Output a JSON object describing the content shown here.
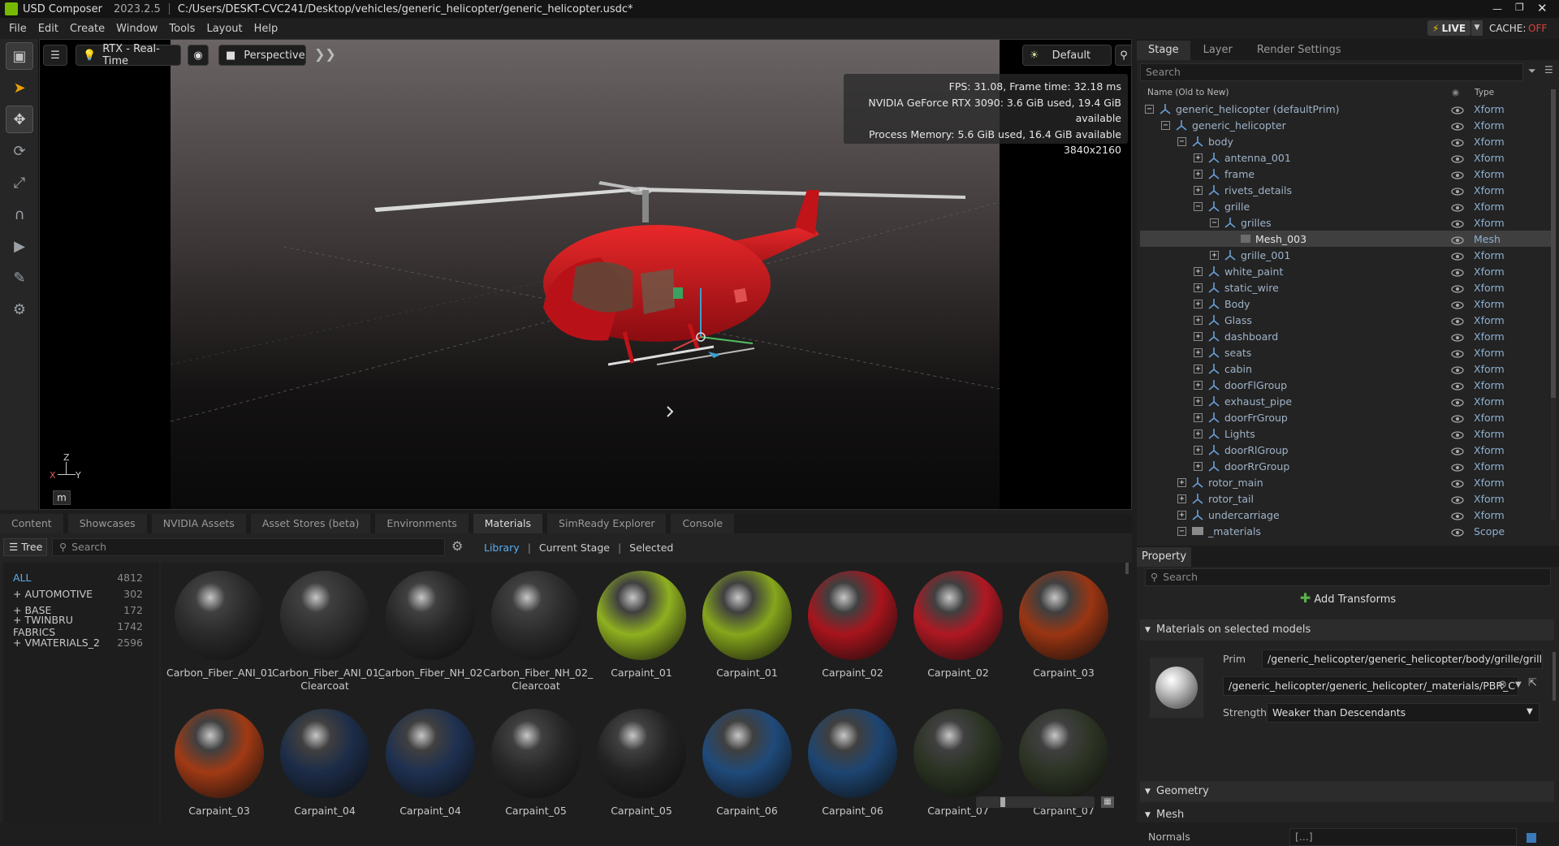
{
  "app": {
    "name": "USD Composer",
    "version": "2023.2.5",
    "file_path": "C:/Users/DESKT-CVC241/Desktop/vehicles/generic_helicopter/generic_helicopter.usdc*"
  },
  "menu": [
    "File",
    "Edit",
    "Create",
    "Window",
    "Tools",
    "Layout",
    "Help"
  ],
  "status": {
    "live": "LIVE",
    "cache_label": "CACHE:",
    "cache_value": "OFF"
  },
  "viewport": {
    "renderer": "RTX - Real-Time",
    "camera": "Perspective",
    "lighting": "Default",
    "stats": [
      "FPS: 31.08, Frame time: 32.18 ms",
      "NVIDIA GeForce RTX 3090: 3.6 GiB used, 19.4 GiB available",
      "Process Memory: 5.6 GiB used, 16.4 GiB available",
      "3840x2160"
    ],
    "axis": {
      "z": "Z",
      "x": "X",
      "y": "Y"
    },
    "unit": "m"
  },
  "stage": {
    "tabs": [
      "Stage",
      "Layer",
      "Render Settings"
    ],
    "search_placeholder": "Search",
    "col_name": "Name (Old to New)",
    "col_type": "Type",
    "rows": [
      {
        "name": "generic_helicopter (defaultPrim)",
        "type": "Xform",
        "toggle": "−"
      },
      {
        "name": "generic_helicopter",
        "type": "Xform",
        "toggle": "−"
      },
      {
        "name": "body",
        "type": "Xform",
        "toggle": "−"
      },
      {
        "name": "antenna_001",
        "type": "Xform",
        "toggle": "+"
      },
      {
        "name": "frame",
        "type": "Xform",
        "toggle": "+"
      },
      {
        "name": "rivets_details",
        "type": "Xform",
        "toggle": "+"
      },
      {
        "name": "grille",
        "type": "Xform",
        "toggle": "−"
      },
      {
        "name": "grilles",
        "type": "Xform",
        "toggle": "−"
      },
      {
        "name": "Mesh_003",
        "type": "Mesh",
        "toggle": ""
      },
      {
        "name": "grille_001",
        "type": "Xform",
        "toggle": "+"
      },
      {
        "name": "white_paint",
        "type": "Xform",
        "toggle": "+"
      },
      {
        "name": "static_wire",
        "type": "Xform",
        "toggle": "+"
      },
      {
        "name": "Body",
        "type": "Xform",
        "toggle": "+"
      },
      {
        "name": "Glass",
        "type": "Xform",
        "toggle": "+"
      },
      {
        "name": "dashboard",
        "type": "Xform",
        "toggle": "+"
      },
      {
        "name": "seats",
        "type": "Xform",
        "toggle": "+"
      },
      {
        "name": "cabin",
        "type": "Xform",
        "toggle": "+"
      },
      {
        "name": "doorFlGroup",
        "type": "Xform",
        "toggle": "+"
      },
      {
        "name": "exhaust_pipe",
        "type": "Xform",
        "toggle": "+"
      },
      {
        "name": "doorFrGroup",
        "type": "Xform",
        "toggle": "+"
      },
      {
        "name": "Lights",
        "type": "Xform",
        "toggle": "+"
      },
      {
        "name": "doorRlGroup",
        "type": "Xform",
        "toggle": "+"
      },
      {
        "name": "doorRrGroup",
        "type": "Xform",
        "toggle": "+"
      },
      {
        "name": "rotor_main",
        "type": "Xform",
        "toggle": "+"
      },
      {
        "name": "rotor_tail",
        "type": "Xform",
        "toggle": "+"
      },
      {
        "name": "undercarriage",
        "type": "Xform",
        "toggle": "+"
      },
      {
        "name": "_materials",
        "type": "Scope",
        "toggle": "−"
      }
    ]
  },
  "property": {
    "tab": "Property",
    "search_placeholder": "Search",
    "add_transforms": "Add Transforms",
    "materials_section": "Materials on selected models",
    "prim_label": "Prim",
    "prim_value": "/generic_helicopter/generic_helicopter/body/grille/grilles/M",
    "material_value": "/generic_helicopter/generic_helicopter/_materials/PBR_C",
    "strength_label": "Strength",
    "strength_value": "Weaker than Descendants",
    "geometry_section": "Geometry",
    "mesh_section": "Mesh",
    "normals_label": "Normals",
    "normals_value": "[...]"
  },
  "bottom": {
    "tabs": [
      "Content",
      "Showcases",
      "NVIDIA Assets",
      "Asset Stores (beta)",
      "Environments",
      "Materials",
      "SimReady Explorer",
      "Console"
    ],
    "tree_label": "Tree",
    "search_placeholder": "Search",
    "filters": [
      "Library",
      "Current Stage",
      "Selected"
    ],
    "categories": [
      {
        "name": "ALL",
        "count": "4812"
      },
      {
        "name": "+ AUTOMOTIVE",
        "count": "302"
      },
      {
        "name": "+ BASE",
        "count": "172"
      },
      {
        "name": "+ TWINBRU FABRICS",
        "count": "1742"
      },
      {
        "name": "+ VMATERIALS_2",
        "count": "2596"
      }
    ],
    "materials_row1": [
      {
        "l1": "Carbon_Fiber_ANI_01",
        "l2": "",
        "c": "#2a2a2a"
      },
      {
        "l1": "Carbon_Fiber_ANI_01_",
        "l2": "Clearcoat",
        "c": "#2e2e2e"
      },
      {
        "l1": "Carbon_Fiber_NH_02",
        "l2": "",
        "c": "#262626"
      },
      {
        "l1": "Carbon_Fiber_NH_02_",
        "l2": "Clearcoat",
        "c": "#2b2b2b"
      },
      {
        "l1": "Carpaint_01",
        "l2": "",
        "c": "#8fb020"
      },
      {
        "l1": "Carpaint_01",
        "l2": "",
        "c": "#86a61c"
      },
      {
        "l1": "Carpaint_02",
        "l2": "",
        "c": "#a8141c"
      },
      {
        "l1": "Carpaint_02",
        "l2": "",
        "c": "#b01822"
      },
      {
        "l1": "Carpaint_03",
        "l2": "",
        "c": "#9a3512"
      }
    ],
    "materials_row2": [
      {
        "l1": "Carpaint_03",
        "c": "#a13a14"
      },
      {
        "l1": "Carpaint_04",
        "c": "#1c2c48"
      },
      {
        "l1": "Carpaint_04",
        "c": "#1e3050"
      },
      {
        "l1": "Carpaint_05",
        "c": "#262626"
      },
      {
        "l1": "Carpaint_05",
        "c": "#222222"
      },
      {
        "l1": "Carpaint_06",
        "c": "#1f4a7a"
      },
      {
        "l1": "Carpaint_06",
        "c": "#1d4572"
      },
      {
        "l1": "Carpaint_07",
        "c": "#2a3322"
      },
      {
        "l1": "Carpaint_07",
        "c": "#2c3424"
      }
    ]
  }
}
